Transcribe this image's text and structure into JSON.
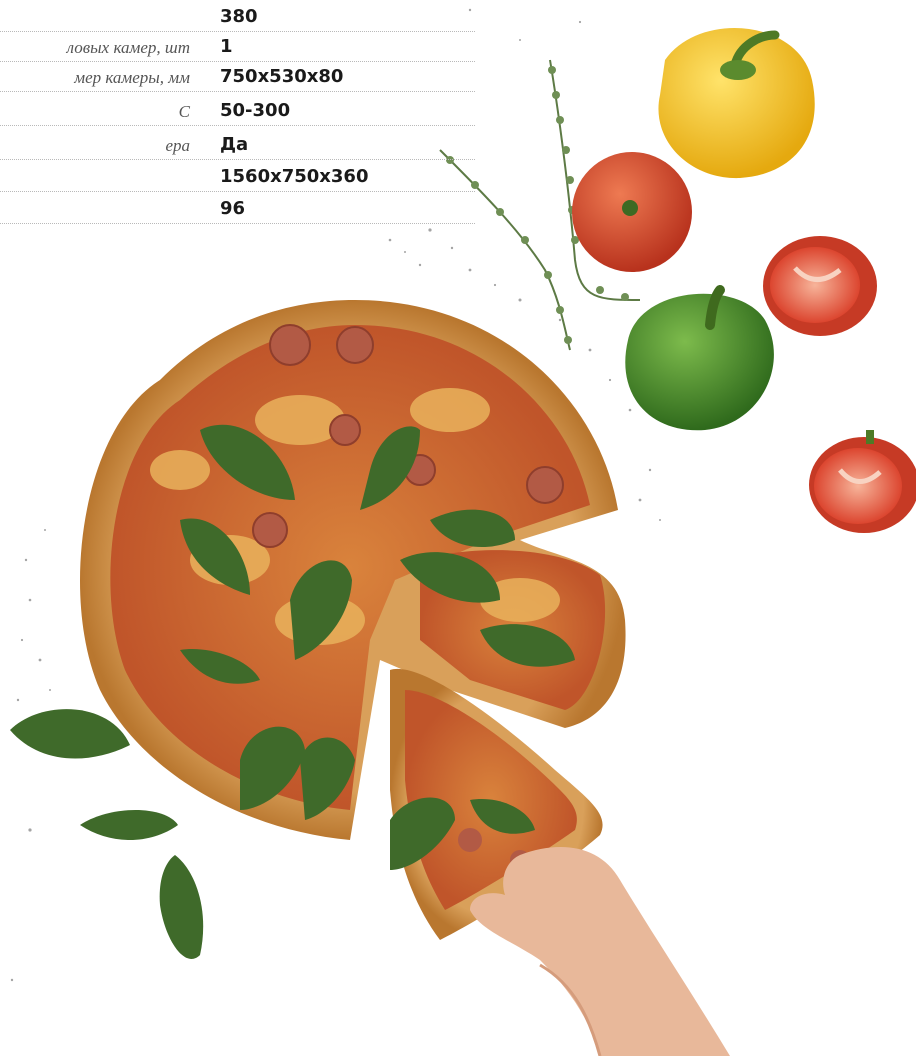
{
  "specs": {
    "rows": [
      {
        "label": "",
        "value": "380"
      },
      {
        "label": "ловых камер, шт",
        "value": "1"
      },
      {
        "label": "мер камеры, мм",
        "value": "750x530x80"
      },
      {
        "label": "C",
        "value": "50-300"
      },
      {
        "label": "ера",
        "value": "Да"
      },
      {
        "label": "",
        "value": "1560x750x360"
      },
      {
        "label": "",
        "value": "96"
      }
    ]
  },
  "image": {
    "subject": "pizza with basil, peppers, tomatoes and thyme on white background",
    "colors": {
      "crust": "#c98a3e",
      "sauce": "#c4542a",
      "basil": "#3f6a2a",
      "yellow_pepper": "#f2c21b",
      "green_pepper": "#4e8a2c",
      "tomato": "#d8432c",
      "skin": "#e8b89a"
    }
  }
}
